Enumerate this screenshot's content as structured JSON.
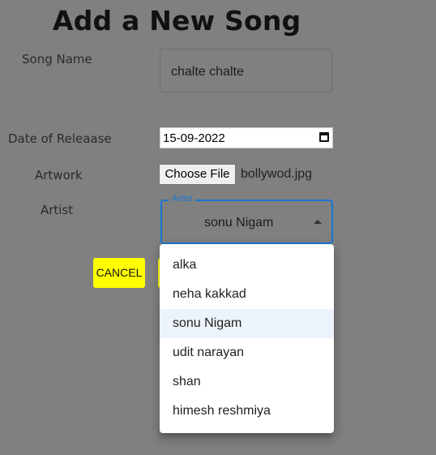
{
  "page": {
    "title": "Add a New Song"
  },
  "form": {
    "song_name": {
      "label": "Song Name",
      "value": "chalte chalte"
    },
    "release_date": {
      "label": "Date of Releaase",
      "value": "15-09-2022"
    },
    "artwork": {
      "label": "Artwork",
      "button_label": "Choose File",
      "file_name": "bollywod.jpg"
    },
    "artist": {
      "label": "Artist",
      "field_label": "Artist",
      "value": "sonu Nigam"
    }
  },
  "buttons": {
    "cancel_label": "CANCEL"
  },
  "artist_menu": {
    "options": [
      "alka",
      "neha kakkad",
      "sonu Nigam",
      "udit narayan",
      "shan",
      "himesh reshmiya"
    ],
    "selected": "sonu Nigam"
  },
  "colors": {
    "backdrop": "#808080",
    "accent": "#1976d2",
    "button": "#ffff00"
  }
}
